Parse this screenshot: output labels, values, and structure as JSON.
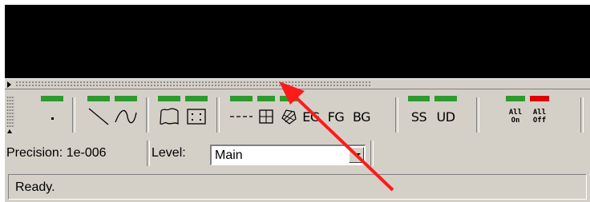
{
  "toolbar": {
    "buttons": [
      {
        "name": "point-tool",
        "led": "green",
        "icon": "dot-icon"
      },
      {
        "name": "line-tool",
        "led": "green",
        "icon": "line-icon"
      },
      {
        "name": "curve-tool",
        "led": "green",
        "icon": "curve-icon"
      },
      {
        "name": "freeform-region-tool",
        "led": "green",
        "icon": "freeform-icon"
      },
      {
        "name": "rectangle-region-tool",
        "led": "green",
        "icon": "dotted-rect-icon"
      },
      {
        "name": "dashed-line-tool",
        "led": "green",
        "icon": "dashed-line-icon"
      },
      {
        "name": "grid-tool",
        "led": "green",
        "icon": "grid-icon"
      },
      {
        "name": "pattern-tool",
        "led": "green",
        "icon": "hatched-shape-icon"
      }
    ],
    "eg_label": "EG",
    "fg_label": "FG",
    "bg_label": "BG",
    "ss_label": "SS",
    "ud_label": "UD",
    "all_on_line1": "All",
    "all_on_line2": "On",
    "all_off_line1": "All",
    "all_off_line2": "Off",
    "colors": {
      "led_green": "#2d9a2d",
      "led_red": "#e00000"
    }
  },
  "status": {
    "precision": "Precision: 1e-006",
    "level_label": "Level:",
    "level_value": "Main",
    "message": "Ready."
  },
  "annotation": {
    "arrow_color": "#ff0000"
  }
}
